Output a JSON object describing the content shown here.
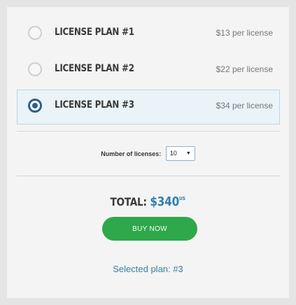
{
  "plans": [
    {
      "name": "LICENSE PLAN #1",
      "price": "$13 per license",
      "selected": false
    },
    {
      "name": "LICENSE PLAN #2",
      "price": "$22 per license",
      "selected": false
    },
    {
      "name": "LICENSE PLAN #3",
      "price": "$34 per license",
      "selected": true
    }
  ],
  "licenses": {
    "label": "Number of licenses:",
    "value": "10",
    "arrow": "▼"
  },
  "total": {
    "label": "TOTAL:",
    "amount": "$340",
    "currency": "US"
  },
  "buy_label": "BUY NOW",
  "selected_plan": {
    "label": "Selected plan:",
    "value": "#3"
  },
  "colors": {
    "accent": "#2d7fb0",
    "button": "#2ea84a",
    "radio_on": "#2f5f84"
  }
}
